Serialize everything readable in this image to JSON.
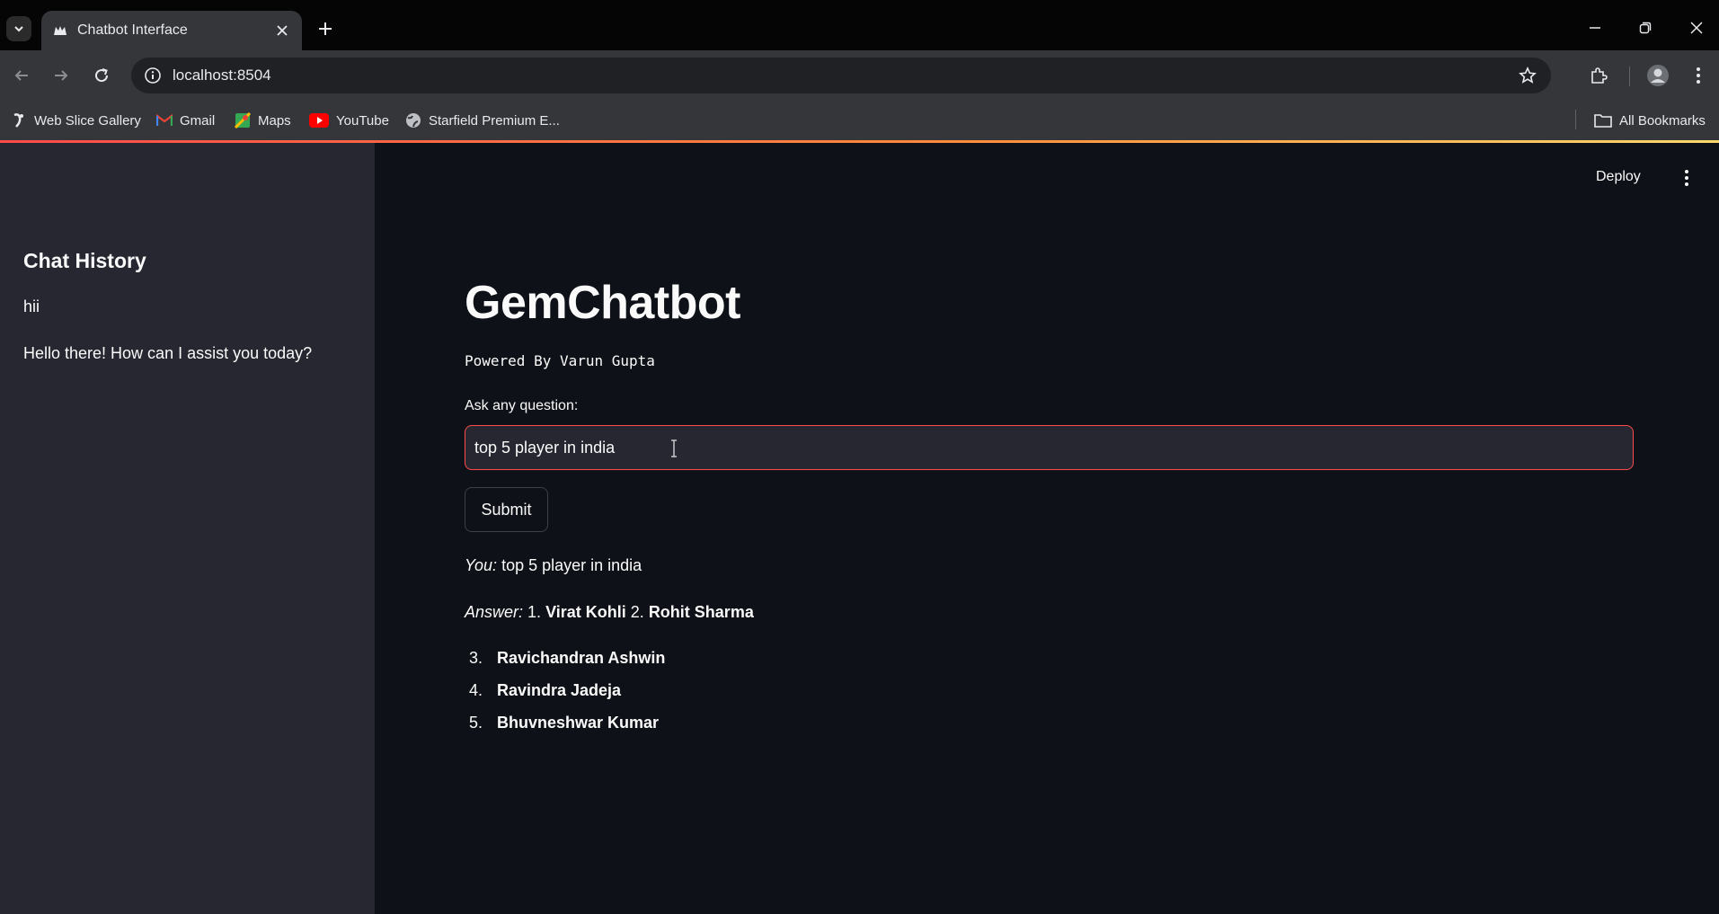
{
  "browser": {
    "tab_title": "Chatbot Interface",
    "url": "localhost:8504",
    "bookmarks": [
      {
        "label": "Web Slice Gallery",
        "icon": "web-slice-icon"
      },
      {
        "label": "Gmail",
        "icon": "gmail-icon"
      },
      {
        "label": "Maps",
        "icon": "maps-icon"
      },
      {
        "label": "YouTube",
        "icon": "youtube-icon"
      },
      {
        "label": "Starfield Premium E...",
        "icon": "globe-icon"
      }
    ],
    "all_bookmarks_label": "All Bookmarks"
  },
  "sidebar": {
    "title": "Chat History",
    "history": [
      "hii",
      "Hello there! How can I assist you today?"
    ]
  },
  "header": {
    "deploy_label": "Deploy"
  },
  "main": {
    "title": "GemChatbot",
    "subtitle": "Powered By Varun Gupta",
    "input_label": "Ask any question:",
    "input_value": "top 5 player in india",
    "submit_label": "Submit",
    "you_prefix": "You:",
    "you_text": "top 5 player in india",
    "answer_prefix": "Answer:",
    "answer_inline": [
      {
        "num": "1.",
        "name": "Virat Kohli"
      },
      {
        "num": "2.",
        "name": "Rohit Sharma"
      }
    ],
    "answer_list": [
      {
        "num": "3.",
        "name": "Ravichandran Ashwin"
      },
      {
        "num": "4.",
        "name": "Ravindra Jadeja"
      },
      {
        "num": "5.",
        "name": "Bhuvneshwar Kumar"
      }
    ]
  },
  "colors": {
    "accent": "#ff4b4b",
    "sidebar_bg": "#262730",
    "main_bg": "#0e1117"
  }
}
